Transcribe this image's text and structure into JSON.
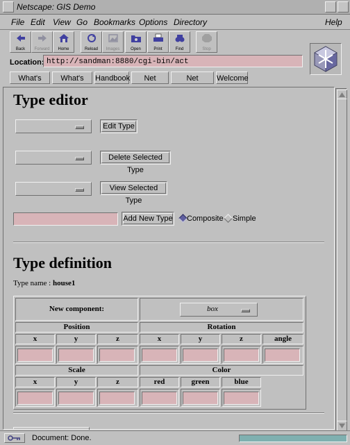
{
  "window": {
    "title": "Netscape: GIS Demo"
  },
  "menu": {
    "file": "File",
    "edit": "Edit",
    "view": "View",
    "go": "Go",
    "bookmarks": "Bookmarks",
    "options": "Options",
    "directory": "Directory",
    "help": "Help"
  },
  "toolbar": {
    "back": "Back",
    "forward": "Forward",
    "home": "Home",
    "reload": "Reload",
    "images": "Images",
    "open": "Open",
    "print": "Print",
    "find": "Find",
    "stop": "Stop"
  },
  "location": {
    "label": "Location:",
    "url": "http://sandman:8880/cgi-bin/act"
  },
  "directory_buttons": {
    "whats_new": "What's New",
    "whats_cool": "What's Cool",
    "handbook": "Handbook",
    "net_search": "Net Search",
    "net_directory": "Net Directory",
    "welcome": "Welcome"
  },
  "type_editor": {
    "heading": "Type editor",
    "edit_type": "Edit Type",
    "delete_selected_type": "Delete Selected Type",
    "view_selected_type": "View Selected Type",
    "add_new_type": "Add New Type",
    "composite": "Composite",
    "simple": "Simple"
  },
  "type_definition": {
    "heading": "Type definition",
    "type_name_label": "Type name :",
    "type_name_value": "house1",
    "new_component_label": "New component:",
    "new_component_value": "box",
    "position": "Position",
    "rotation": "Rotation",
    "scale": "Scale",
    "color": "Color",
    "x": "x",
    "y": "y",
    "z": "z",
    "angle": "angle",
    "red": "red",
    "green": "green",
    "blue": "blue"
  },
  "status": {
    "text": "Document: Done."
  }
}
